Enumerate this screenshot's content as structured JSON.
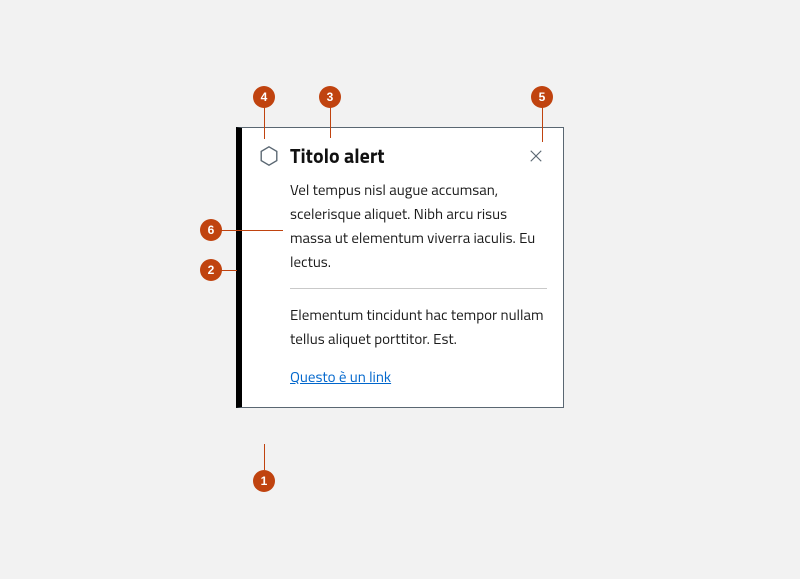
{
  "alert": {
    "title": "Titolo alert",
    "para1": "Vel tempus nisl augue accumsan, scelerisque aliquet. Nibh arcu risus massa ut elementum viverra iaculis. Eu lectus.",
    "para2": "Elementum tincidunt hac tempor nullam tellus aliquet porttitor. Est.",
    "link_label": "Questo è un link"
  },
  "annotations": {
    "n1": "1",
    "n2": "2",
    "n3": "3",
    "n4": "4",
    "n5": "5",
    "n6": "6"
  }
}
